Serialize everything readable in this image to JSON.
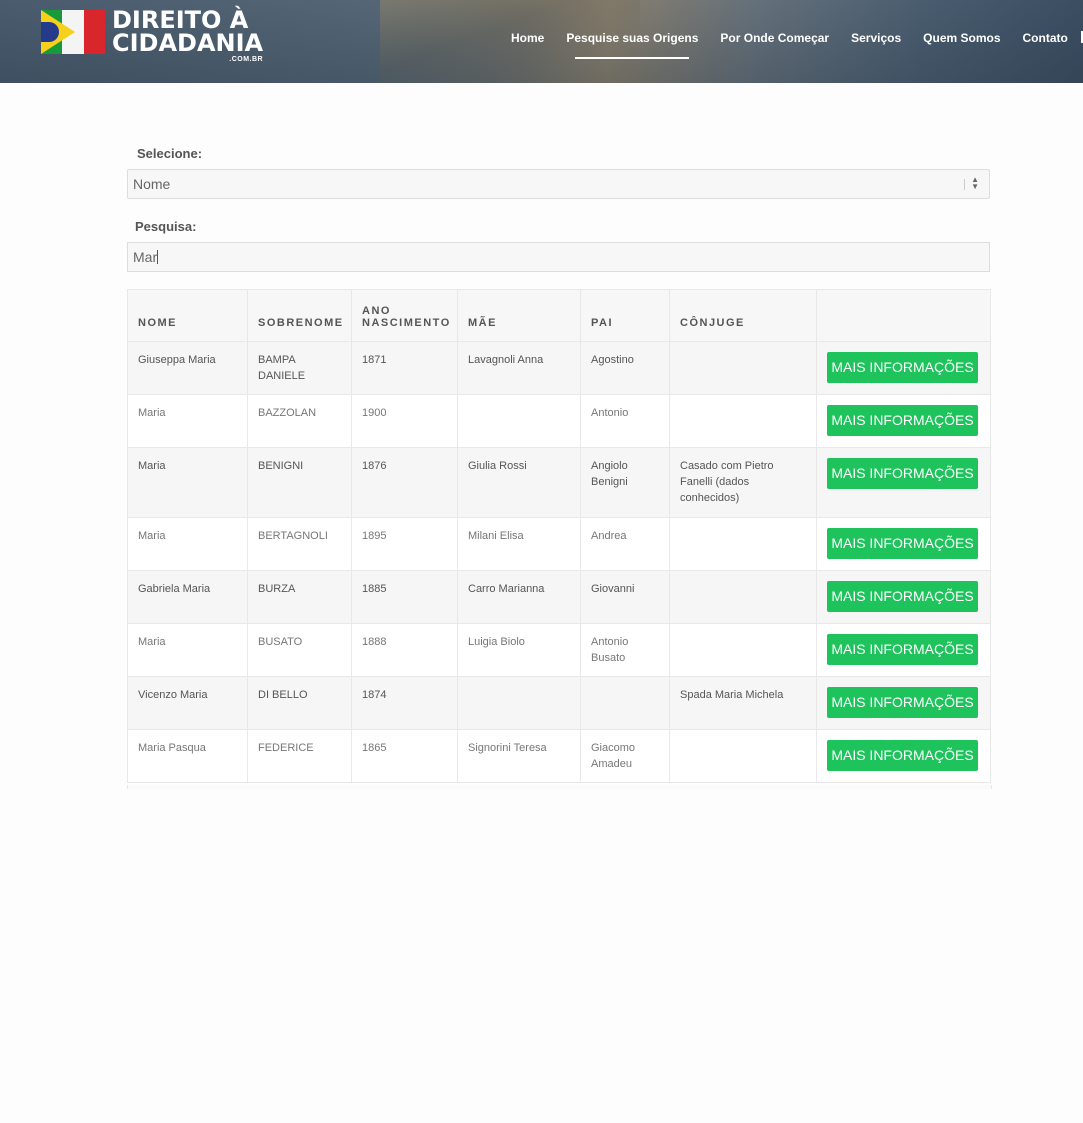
{
  "brand": {
    "line1": "DIREITO À",
    "line2": "CIDADANIA",
    "suffix": ".COM.BR"
  },
  "nav": {
    "items": [
      {
        "label": "Home"
      },
      {
        "label": "Pesquise suas Origens",
        "active": true
      },
      {
        "label": "Por Onde Começar"
      },
      {
        "label": "Serviços"
      },
      {
        "label": "Quem Somos"
      },
      {
        "label": "Contato"
      }
    ]
  },
  "filter": {
    "select_label": "Selecione:",
    "select_value": "Nome",
    "search_label": "Pesquisa:",
    "search_value": "Mar"
  },
  "table": {
    "columns": [
      "NOME",
      "SOBRENOME",
      "ANO NASCIMENTO",
      "MÃE",
      "PAI",
      "CÔNJUGE",
      ""
    ],
    "button_label": "MAIS INFORMAÇÕES",
    "rows": [
      {
        "nome": "Giuseppa Maria",
        "sobrenome": "BAMPA DANIELE",
        "ano": "1871",
        "mae": "Lavagnoli Anna",
        "pai": "Agostino",
        "conjuge": ""
      },
      {
        "nome": "Maria",
        "sobrenome": "BAZZOLAN",
        "ano": "1900",
        "mae": "",
        "pai": "Antonio",
        "conjuge": ""
      },
      {
        "nome": "Maria",
        "sobrenome": "BENIGNI",
        "ano": "1876",
        "mae": "Giulia Rossi",
        "pai": "Angiolo Benigni",
        "conjuge": "Casado com Pietro Fanelli (dados conhecidos)"
      },
      {
        "nome": "Maria",
        "sobrenome": "BERTAGNOLI",
        "ano": "1895",
        "mae": "Milani Elisa",
        "pai": "Andrea",
        "conjuge": ""
      },
      {
        "nome": "Gabriela Maria",
        "sobrenome": "BURZA",
        "ano": "1885",
        "mae": "Carro Marianna",
        "pai": "Giovanni",
        "conjuge": ""
      },
      {
        "nome": "Maria",
        "sobrenome": "BUSATO",
        "ano": "1888",
        "mae": "Luigia Biolo",
        "pai": "Antonio Busato",
        "conjuge": ""
      },
      {
        "nome": "Vicenzo Maria",
        "sobrenome": "DI BELLO",
        "ano": "1874",
        "mae": "",
        "pai": "",
        "conjuge": "Spada Maria Michela"
      },
      {
        "nome": "Maria Pasqua",
        "sobrenome": "FEDERICE",
        "ano": "1865",
        "mae": "Signorini Teresa",
        "pai": "Giacomo Amadeu",
        "conjuge": ""
      }
    ]
  }
}
